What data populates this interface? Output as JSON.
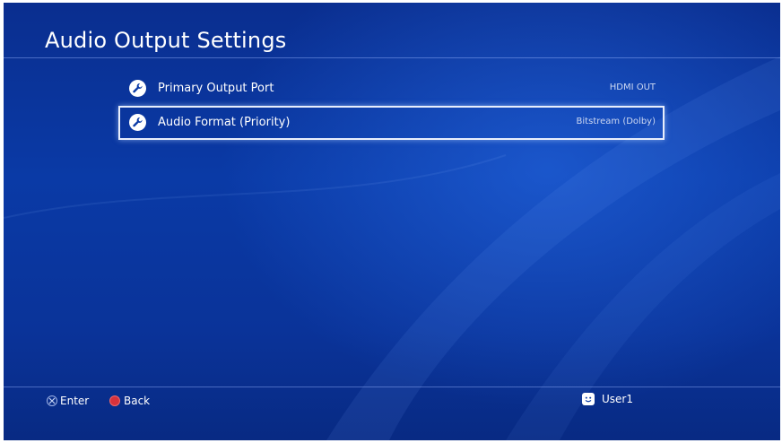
{
  "page": {
    "title": "Audio Output Settings"
  },
  "settings": {
    "items": [
      {
        "label": "Primary Output Port",
        "value": "HDMI OUT",
        "icon": "wrench-icon",
        "selected": false
      },
      {
        "label": "Audio Format (Priority)",
        "value": "Bitstream (Dolby)",
        "icon": "wrench-icon",
        "selected": true
      }
    ]
  },
  "footer": {
    "enter_label": "Enter",
    "enter_icon": "cross-button-icon",
    "back_label": "Back",
    "back_icon": "circle-button-icon",
    "user_name": "User1",
    "user_icon": "user-avatar-icon"
  },
  "colors": {
    "background": "#0a3aa6",
    "text": "#ffffff",
    "selection_border": "#e8eefc",
    "circle_button": "#d8323c"
  }
}
